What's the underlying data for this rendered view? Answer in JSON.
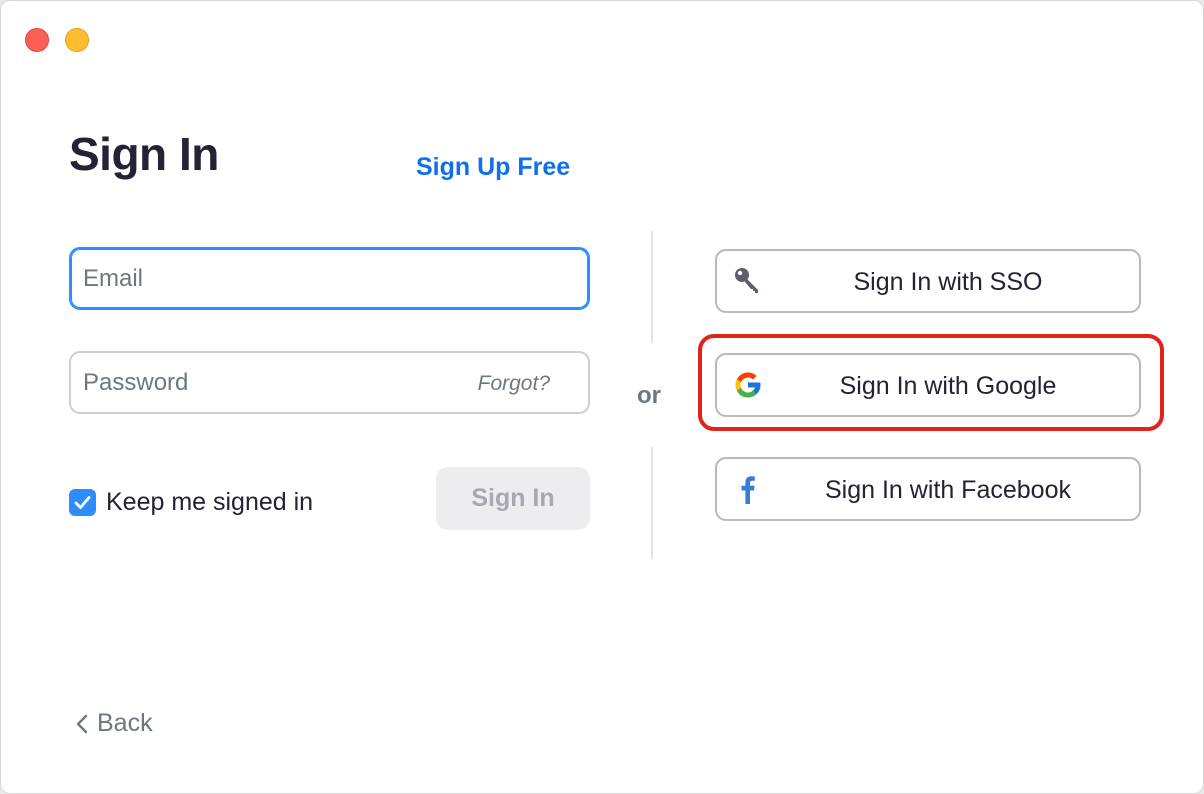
{
  "title": "Sign In",
  "signup_link": "Sign Up Free",
  "email": {
    "placeholder": "Email",
    "value": ""
  },
  "password": {
    "placeholder": "Password",
    "value": "",
    "forgot": "Forgot?"
  },
  "keep_signed_in": {
    "label": "Keep me signed in",
    "checked": true
  },
  "signin_button": "Sign In",
  "divider_text": "or",
  "sso_buttons": [
    {
      "label": "Sign In with SSO",
      "icon": "key-icon"
    },
    {
      "label": "Sign In with Google",
      "icon": "google-icon"
    },
    {
      "label": "Sign In with Facebook",
      "icon": "facebook-icon"
    }
  ],
  "back_label": "Back",
  "colors": {
    "accent": "#0e71eb",
    "focus": "#2d8cff",
    "highlight": "#e2231a",
    "text": "#232333",
    "muted": "#6e7680"
  }
}
